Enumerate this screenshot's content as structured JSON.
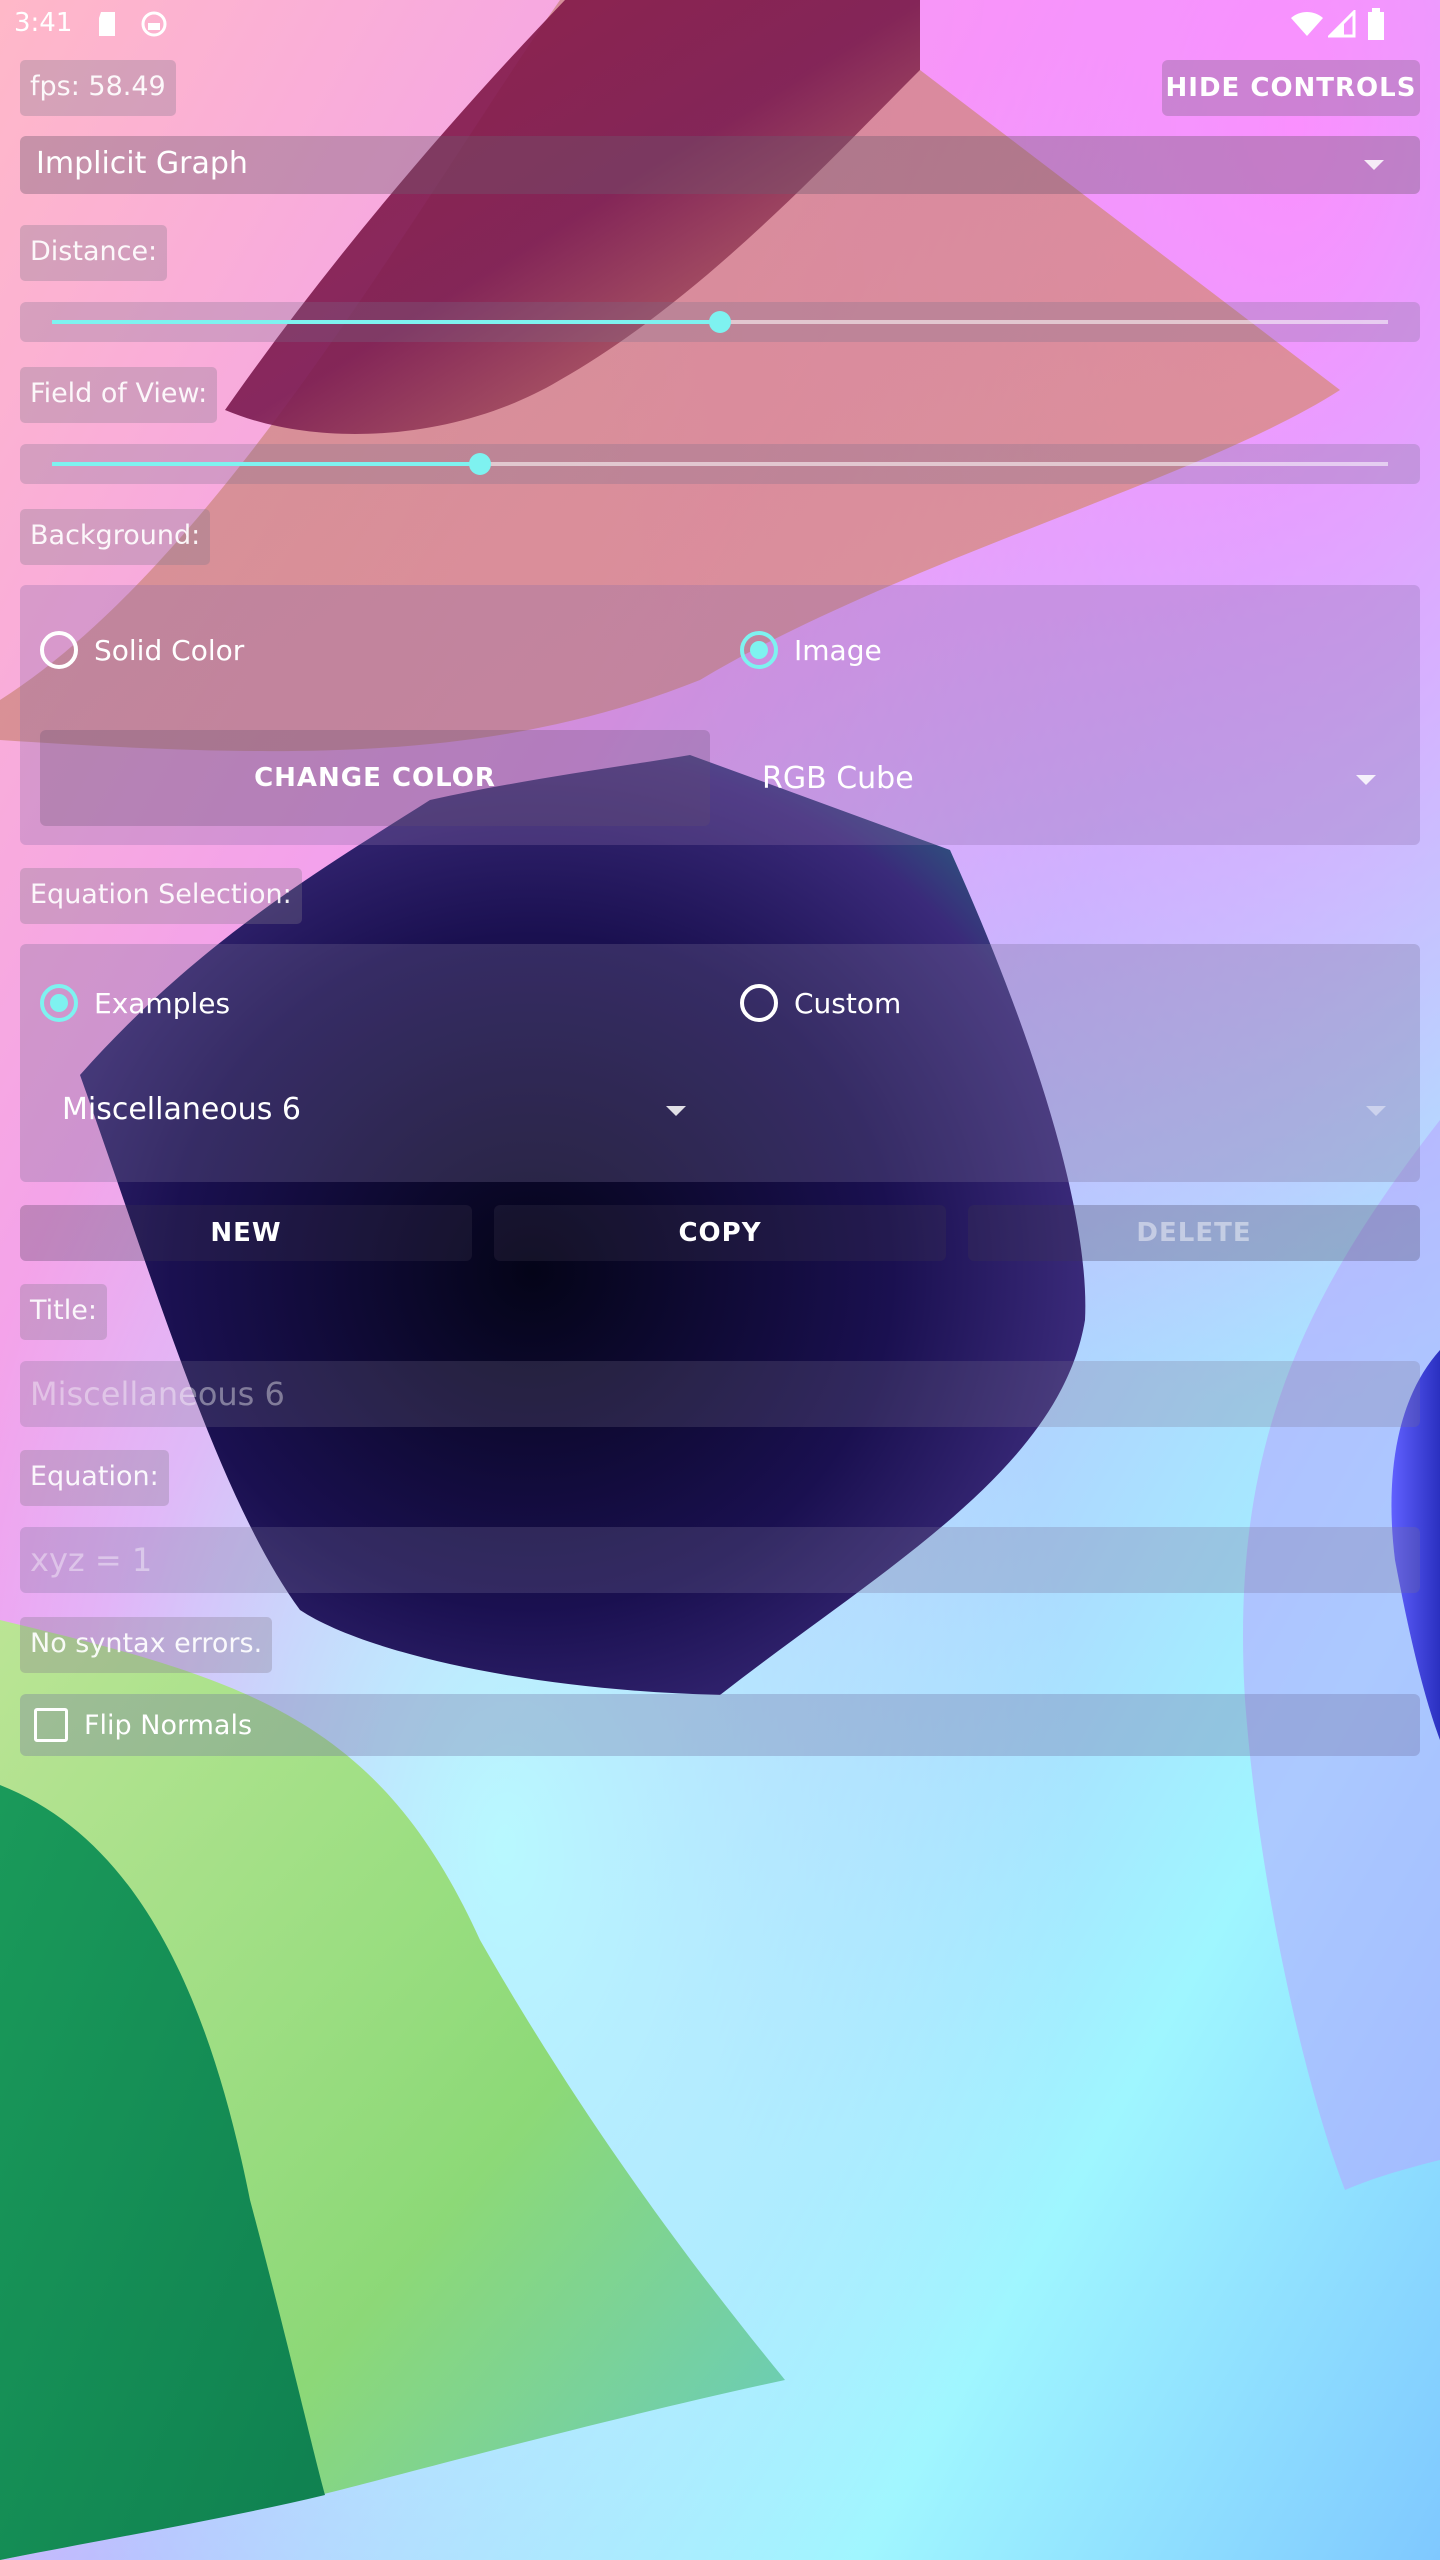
{
  "status_bar": {
    "time": "3:41"
  },
  "fps": "fps: 58.49",
  "hide_controls": "HIDE CONTROLS",
  "mode_select": {
    "value": "Implicit Graph"
  },
  "distance": {
    "label": "Distance:",
    "value": 0.5
  },
  "field_of_view": {
    "label": "Field of View:",
    "value": 0.32
  },
  "background": {
    "label": "Background:",
    "options": [
      "Solid Color",
      "Image"
    ],
    "selected": "Image",
    "change_color": "CHANGE COLOR",
    "image_select": "RGB Cube"
  },
  "equation_selection": {
    "label": "Equation Selection:",
    "options": [
      "Examples",
      "Custom"
    ],
    "selected": "Examples",
    "example_select": "Miscellaneous 6"
  },
  "actions": {
    "new": "NEW",
    "copy": "COPY",
    "delete": "DELETE"
  },
  "title": {
    "label": "Title:",
    "value": "Miscellaneous 6"
  },
  "equation": {
    "label": "Equation:",
    "value": "xyz = 1"
  },
  "syntax_status": "No syntax errors.",
  "flip_normals": {
    "label": "Flip Normals",
    "checked": false
  },
  "colors": {
    "accent": "#7ef2f0"
  }
}
